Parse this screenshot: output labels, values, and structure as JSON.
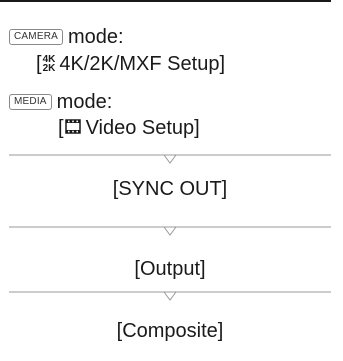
{
  "camera_mode": {
    "badge": "CAMERA",
    "label": "mode:",
    "menu_open": "[",
    "format_icon_top": "4K",
    "format_icon_bottom": "2K",
    "menu_text": "4K/2K/MXF Setup]"
  },
  "media_mode": {
    "badge": "MEDIA",
    "label": "mode:",
    "menu_open": "[",
    "menu_text": "Video Setup]"
  },
  "steps": [
    "[SYNC OUT]",
    "[Output]",
    "[Composite]"
  ],
  "colors": {
    "text": "#1a1a1a",
    "badge_border": "#8a8a8a",
    "divider": "#999999"
  }
}
